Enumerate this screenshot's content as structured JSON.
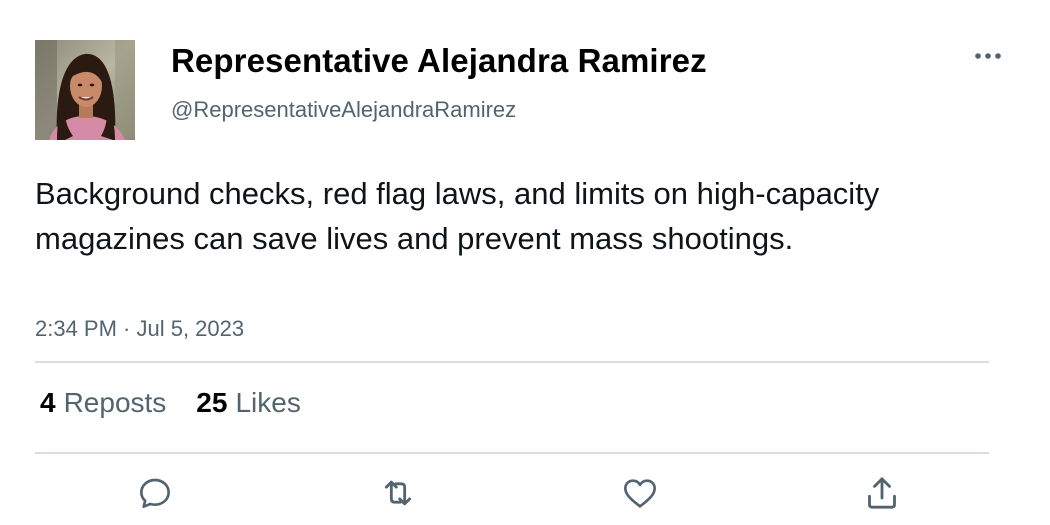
{
  "author": {
    "display_name": "Representative Alejandra Ramirez",
    "handle": "@RepresentativeAlejandraRamirez"
  },
  "tweet": {
    "text": "Background checks, red flag laws, and limits on high-capacity magazines can save lives and prevent mass shootings.",
    "timestamp": "2:34 PM · Jul 5, 2023"
  },
  "stats": {
    "reposts_count": "4",
    "reposts_label": "Reposts",
    "likes_count": "25",
    "likes_label": "Likes"
  },
  "icons": {
    "more": "more-horizontal-icon",
    "reply": "reply-icon",
    "repost": "repost-icon",
    "like": "heart-icon",
    "share": "share-icon"
  },
  "colors": {
    "text_primary": "#0f1419",
    "text_secondary": "#536471",
    "divider": "#d9dde1",
    "icon": "#536471"
  }
}
